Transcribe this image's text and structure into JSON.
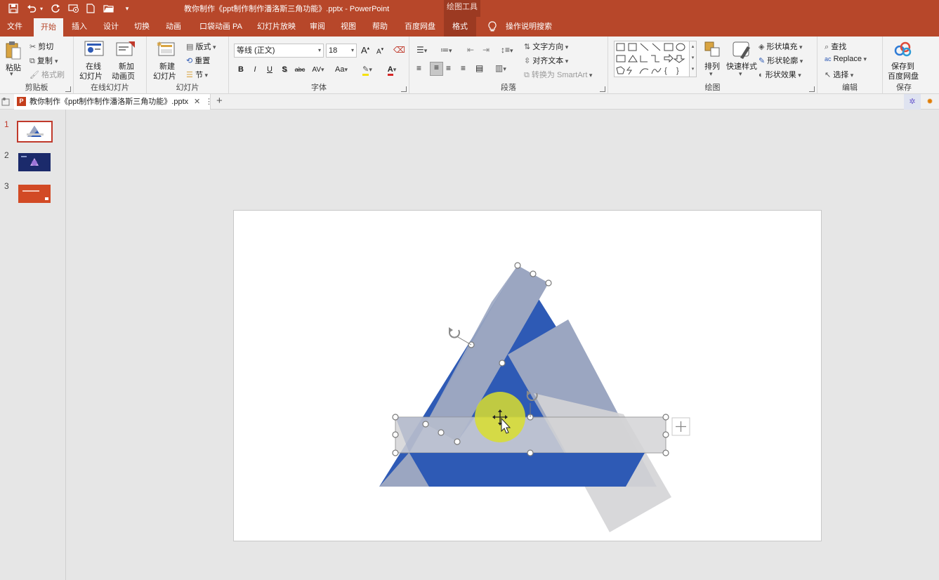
{
  "window": {
    "title": "教你制作《ppt制作制作潘洛斯三角功能》.pptx  -  PowerPoint",
    "context_tools_label": "绘图工具"
  },
  "menu": {
    "tabs": [
      "文件",
      "开始",
      "插入",
      "设计",
      "切换",
      "动画",
      "口袋动画 PA",
      "幻灯片放映",
      "审阅",
      "视图",
      "帮助",
      "百度网盘",
      "格式"
    ],
    "active_tab": "开始",
    "search_label": "操作说明搜索"
  },
  "ribbon": {
    "clipboard": {
      "paste": "粘贴",
      "cut": "剪切",
      "copy": "复制",
      "format_painter": "格式刷",
      "label": "剪贴板"
    },
    "online": {
      "online_slides": "在线\n幻灯片",
      "online_line1": "在线",
      "online_line2": "幻灯片",
      "new_anim_line1": "新加",
      "new_anim_line2": "动画页",
      "label": "在线幻灯片"
    },
    "slides": {
      "new_line1": "新建",
      "new_line2": "幻灯片",
      "layout": "版式",
      "reset": "重置",
      "section": "节",
      "label": "幻灯片"
    },
    "font": {
      "name": "等线 (正文)",
      "size": "18",
      "bold": "B",
      "italic": "I",
      "underline": "U",
      "shadow": "S",
      "strike": "abc",
      "spacing": "AV",
      "case": "Aa",
      "grow": "A",
      "shrink": "A",
      "label": "字体"
    },
    "paragraph": {
      "text_direction": "文字方向",
      "align_text": "对齐文本",
      "smartart": "转换为 SmartArt",
      "label": "段落"
    },
    "drawing": {
      "arrange": "排列",
      "quick_styles": "快速样式",
      "shape_fill": "形状填充",
      "shape_outline": "形状轮廓",
      "shape_effects": "形状效果",
      "label": "绘图"
    },
    "editing": {
      "find": "查找",
      "replace": "Replace",
      "select": "选择",
      "label": "编辑"
    },
    "save": {
      "line1": "保存到",
      "line2": "百度网盘",
      "label": "保存"
    }
  },
  "doc_tab": {
    "title": "教你制作《ppt制作制作潘洛斯三角功能》.pptx"
  },
  "thumbnails": [
    {
      "num": "1",
      "selected": true
    },
    {
      "num": "2",
      "selected": false
    },
    {
      "num": "3",
      "selected": false
    }
  ],
  "colors": {
    "accent": "#b7472a",
    "triangle_blue": "#2e5ab5",
    "band_gray_blue": "#9ba6c1",
    "light_gray": "#d4d4d6",
    "highlight": "#d9de2e"
  }
}
